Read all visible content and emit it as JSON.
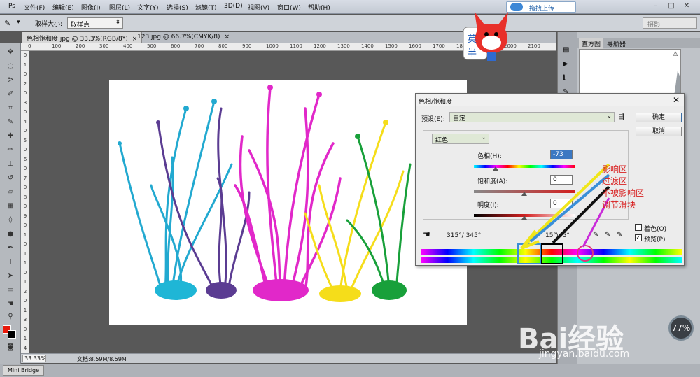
{
  "menubar": {
    "items": [
      "文件(F)",
      "编辑(E)",
      "图像(I)",
      "图层(L)",
      "文字(Y)",
      "选择(S)",
      "滤镜(T)",
      "3D(D)",
      "视图(V)",
      "窗口(W)",
      "帮助(H)"
    ],
    "upload_label": "拖拽上传"
  },
  "options": {
    "sample_size_label": "取样大小:",
    "sample_size_value": "取样点",
    "workspace": "摄影"
  },
  "tabs": [
    {
      "label": "色相饱和度.jpg @ 33.3%(RGB/8*)",
      "active": true
    },
    {
      "label": "123.jpg @ 66.7%(CMYK/8)",
      "active": false
    }
  ],
  "ruler_top": [
    "0",
    "100",
    "200",
    "300",
    "400",
    "500",
    "600",
    "700",
    "800",
    "900",
    "1000",
    "1100",
    "1200",
    "1300",
    "1400",
    "1500",
    "1600",
    "1700",
    "1800",
    "1900",
    "2000",
    "2100"
  ],
  "ruler_left": [
    "0",
    "1",
    "0",
    "2",
    "0",
    "3",
    "0",
    "4",
    "0",
    "5",
    "0",
    "6",
    "0",
    "7",
    "0",
    "8",
    "0",
    "9",
    "0",
    "1",
    "0",
    "1",
    "1",
    "0",
    "1",
    "2",
    "0",
    "1",
    "3",
    "0",
    "1",
    "4"
  ],
  "status": {
    "zoom": "33.33%",
    "doc": "文档:8.59M/8.59M"
  },
  "minibridge": "Mini Bridge",
  "panels": {
    "histogram_tab": "直方图",
    "navigator_tab": "导航器"
  },
  "dialog": {
    "title": "色相/饱和度",
    "preset_label": "预设(E):",
    "preset_value": "自定",
    "ok": "确定",
    "cancel": "取消",
    "channel": "红色",
    "hue_label": "色相(H):",
    "hue_value": "-73",
    "sat_label": "饱和度(A):",
    "sat_value": "0",
    "light_label": "明度(I):",
    "light_value": "0",
    "range_left": "315°/ 345°",
    "range_right": "15°\\45°",
    "colorize_label": "着色(O)",
    "preview_label": "预览(P)"
  },
  "annotations": [
    "影响区",
    "过渡区",
    "不被影响区",
    "调节滑块"
  ],
  "annotation_color": "#d81e1e",
  "mascot_text": [
    "英",
    "半"
  ],
  "watermark": {
    "brand": "Bai经验",
    "url": "jingyan.baidu.com"
  },
  "badge": "77%"
}
